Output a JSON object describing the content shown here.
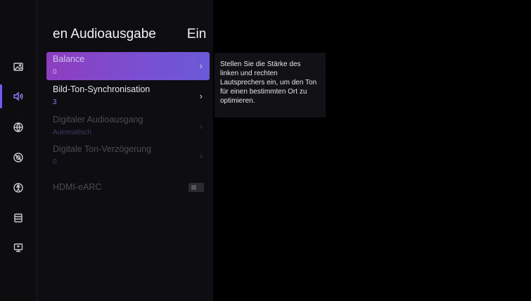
{
  "header": {
    "title": "en Audioausgabe",
    "title_suffix": "Ein"
  },
  "sidebar": {
    "active_index": 1,
    "icons": [
      {
        "name": "picture-icon"
      },
      {
        "name": "sound-icon"
      },
      {
        "name": "network-icon"
      },
      {
        "name": "settings-icon"
      },
      {
        "name": "accessibility-icon"
      },
      {
        "name": "storage-icon"
      },
      {
        "name": "system-icon"
      }
    ]
  },
  "menu": {
    "items": [
      {
        "label": "Balance",
        "value": "0",
        "state": "focused"
      },
      {
        "label": "Bild-Ton-Synchronisation",
        "value": "3",
        "state": "normal"
      },
      {
        "label": "Digitaler Audioausgang",
        "value": "Automatisch",
        "state": "disabled"
      },
      {
        "label": "Digitale Ton-Verzögerung",
        "value": "0",
        "state": "disabled"
      }
    ],
    "hdmi_earc": {
      "label": "HDMI-eARC",
      "enabled": false
    }
  },
  "description": {
    "text": "Stellen Sie die Stärke des linken und rechten Lautsprechers ein, um den Ton für einen bestimmten Ort zu optimieren."
  },
  "colors": {
    "accent": "#6f5cff",
    "focus_gradient_start": "#8f3dbf",
    "focus_gradient_end": "#6a5ad8",
    "value_text": "#8a7dff"
  }
}
